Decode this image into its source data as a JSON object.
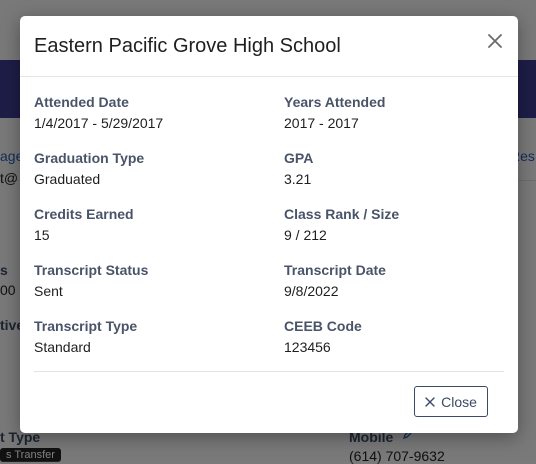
{
  "background": {
    "left_fragments": [
      "age",
      "t@",
      "s",
      "00",
      "tive",
      "t Type"
    ],
    "right_fragments": [
      "Res"
    ],
    "mobile_label": "Mobile",
    "mobile_value": "(614) 707-9632",
    "badge": "s Transfer"
  },
  "modal": {
    "title": "Eastern Pacific Grove High School",
    "fields": [
      {
        "label": "Attended Date",
        "value": "1/4/2017 - 5/29/2017"
      },
      {
        "label": "Years Attended",
        "value": "2017 - 2017"
      },
      {
        "label": "Graduation Type",
        "value": "Graduated"
      },
      {
        "label": "GPA",
        "value": "3.21"
      },
      {
        "label": "Credits Earned",
        "value": "15"
      },
      {
        "label": "Class Rank / Size",
        "value": "9 / 212"
      },
      {
        "label": "Transcript Status",
        "value": "Sent"
      },
      {
        "label": "Transcript Date",
        "value": "9/8/2022"
      },
      {
        "label": "Transcript Type",
        "value": "Standard"
      },
      {
        "label": "CEEB Code",
        "value": "123456"
      }
    ],
    "close_label": "Close"
  },
  "colors": {
    "header_purple": "#3d3a8f",
    "label_slate": "#4a5468",
    "overlay": "rgba(0,0,0,0.5)"
  }
}
